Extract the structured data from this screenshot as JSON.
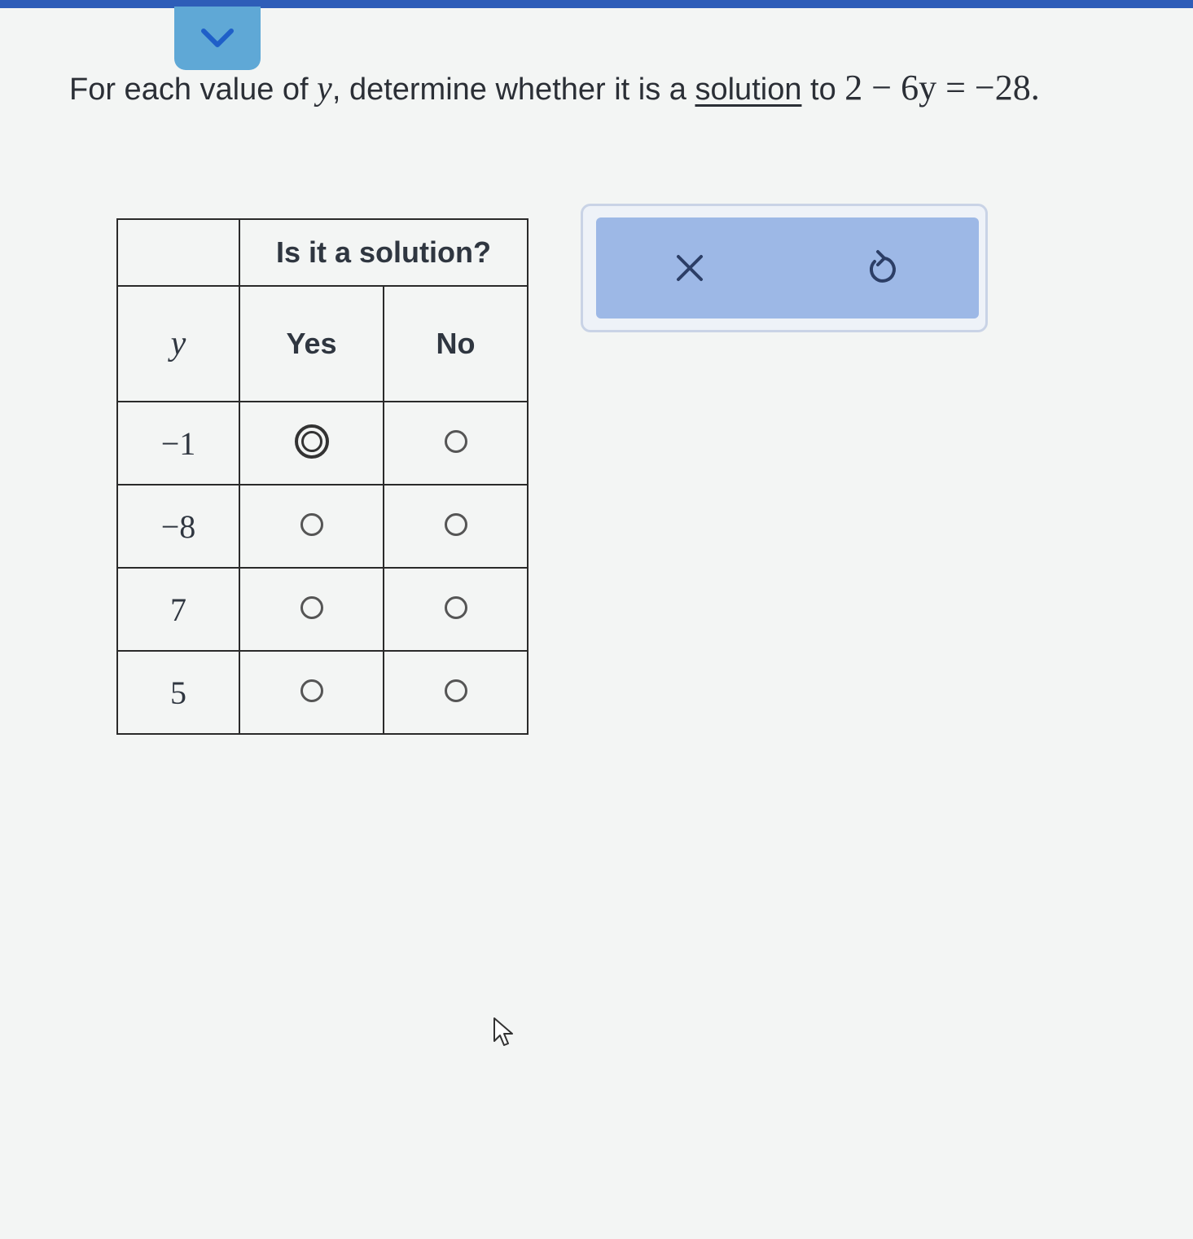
{
  "prompt": {
    "before": "For each value of ",
    "variable": "y",
    "middle": ", determine whether it is a ",
    "link_text": "solution",
    "after_link": " to ",
    "equation": "2 − 6y = −28",
    "end": "."
  },
  "table": {
    "group_header": "Is it a solution?",
    "y_header": "y",
    "columns": [
      "Yes",
      "No"
    ],
    "rows": [
      {
        "y": "−1",
        "selected": "Yes"
      },
      {
        "y": "−8",
        "selected": null
      },
      {
        "y": "7",
        "selected": null
      },
      {
        "y": "5",
        "selected": null
      }
    ]
  },
  "actions": {
    "clear_icon": "close-icon",
    "undo_icon": "undo-icon"
  },
  "colors": {
    "top_strip": "#2e5db8",
    "collapse_tab": "#5fa8d6",
    "action_fill": "#9db8e6"
  }
}
